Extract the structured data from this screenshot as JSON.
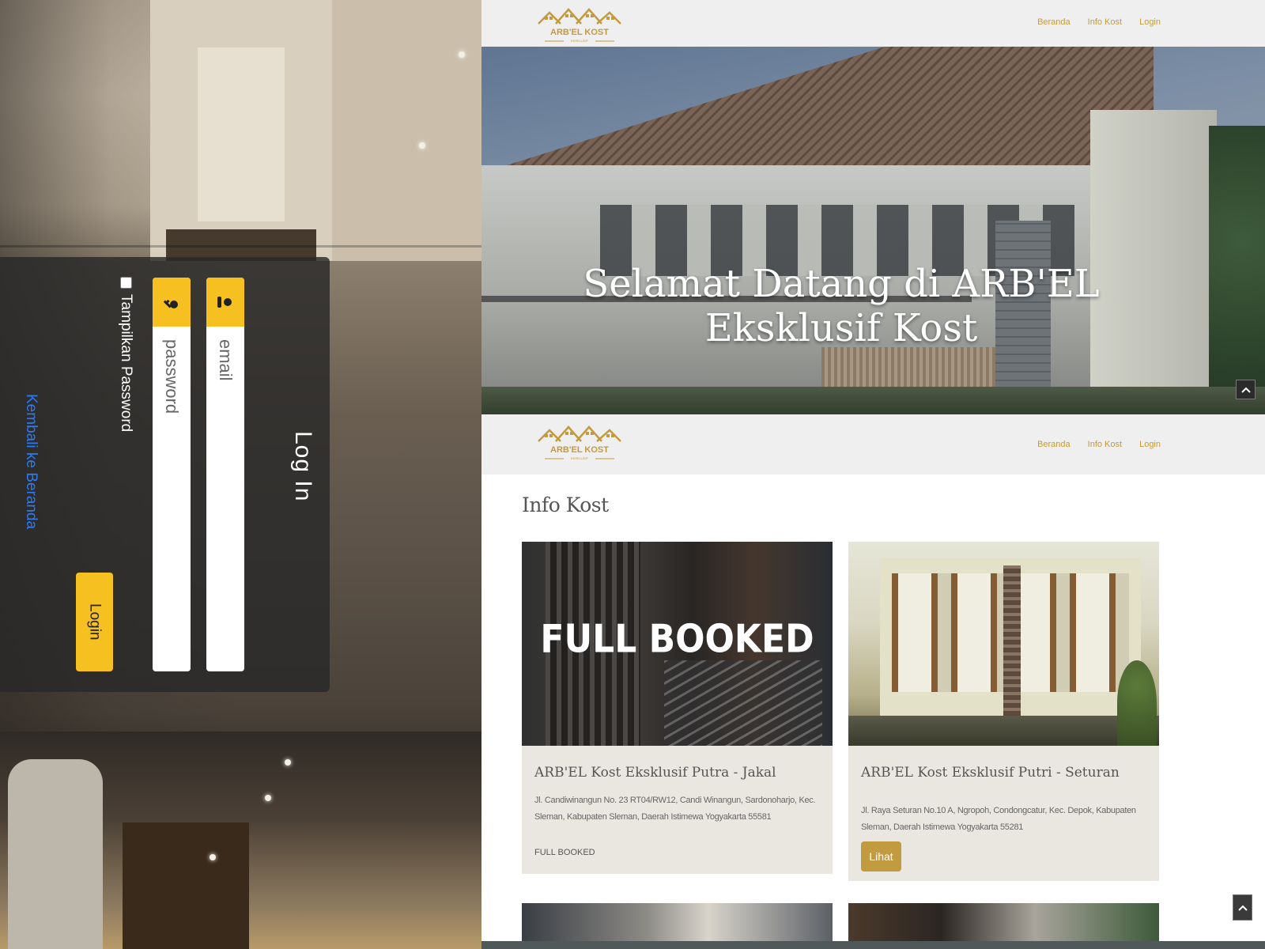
{
  "login_panel": {
    "title": "Log In",
    "email_placeholder": "email",
    "password_placeholder": "password",
    "show_password_label": "Tampilkan Password",
    "login_button": "Login",
    "back_link": "Kembali ke Beranda"
  },
  "site": {
    "logo_text": "ARB'EL KOST",
    "logo_subtext": "EKSKLUSIF",
    "nav": [
      "Beranda",
      "Info Kost",
      "Login"
    ],
    "hero_title": "Selamat Datang di ARB'EL Eksklusif Kost",
    "info_title": "Info Kost",
    "colors": {
      "accent": "#c29a3f",
      "login_yellow": "#f6c021",
      "link_blue": "#2a7bf6"
    },
    "cards": [
      {
        "overlay": "FULL BOOKED",
        "title": "ARB'EL Kost Eksklusif Putra - Jakal",
        "address": "Jl. Candiwinangun No. 23 RT04/RW12, Candi Winangun, Sardonoharjo, Kec. Sleman, Kabupaten Sleman, Daerah Istimewa Yogyakarta 55581",
        "status": "FULL BOOKED"
      },
      {
        "title": "ARB'EL Kost Eksklusif Putri - Seturan",
        "address": "Jl. Raya Seturan No.10 A, Ngropoh, Condongcatur, Kec. Depok, Kabupaten Sleman, Daerah Istimewa Yogyakarta 55281",
        "button": "Lihat"
      }
    ]
  }
}
